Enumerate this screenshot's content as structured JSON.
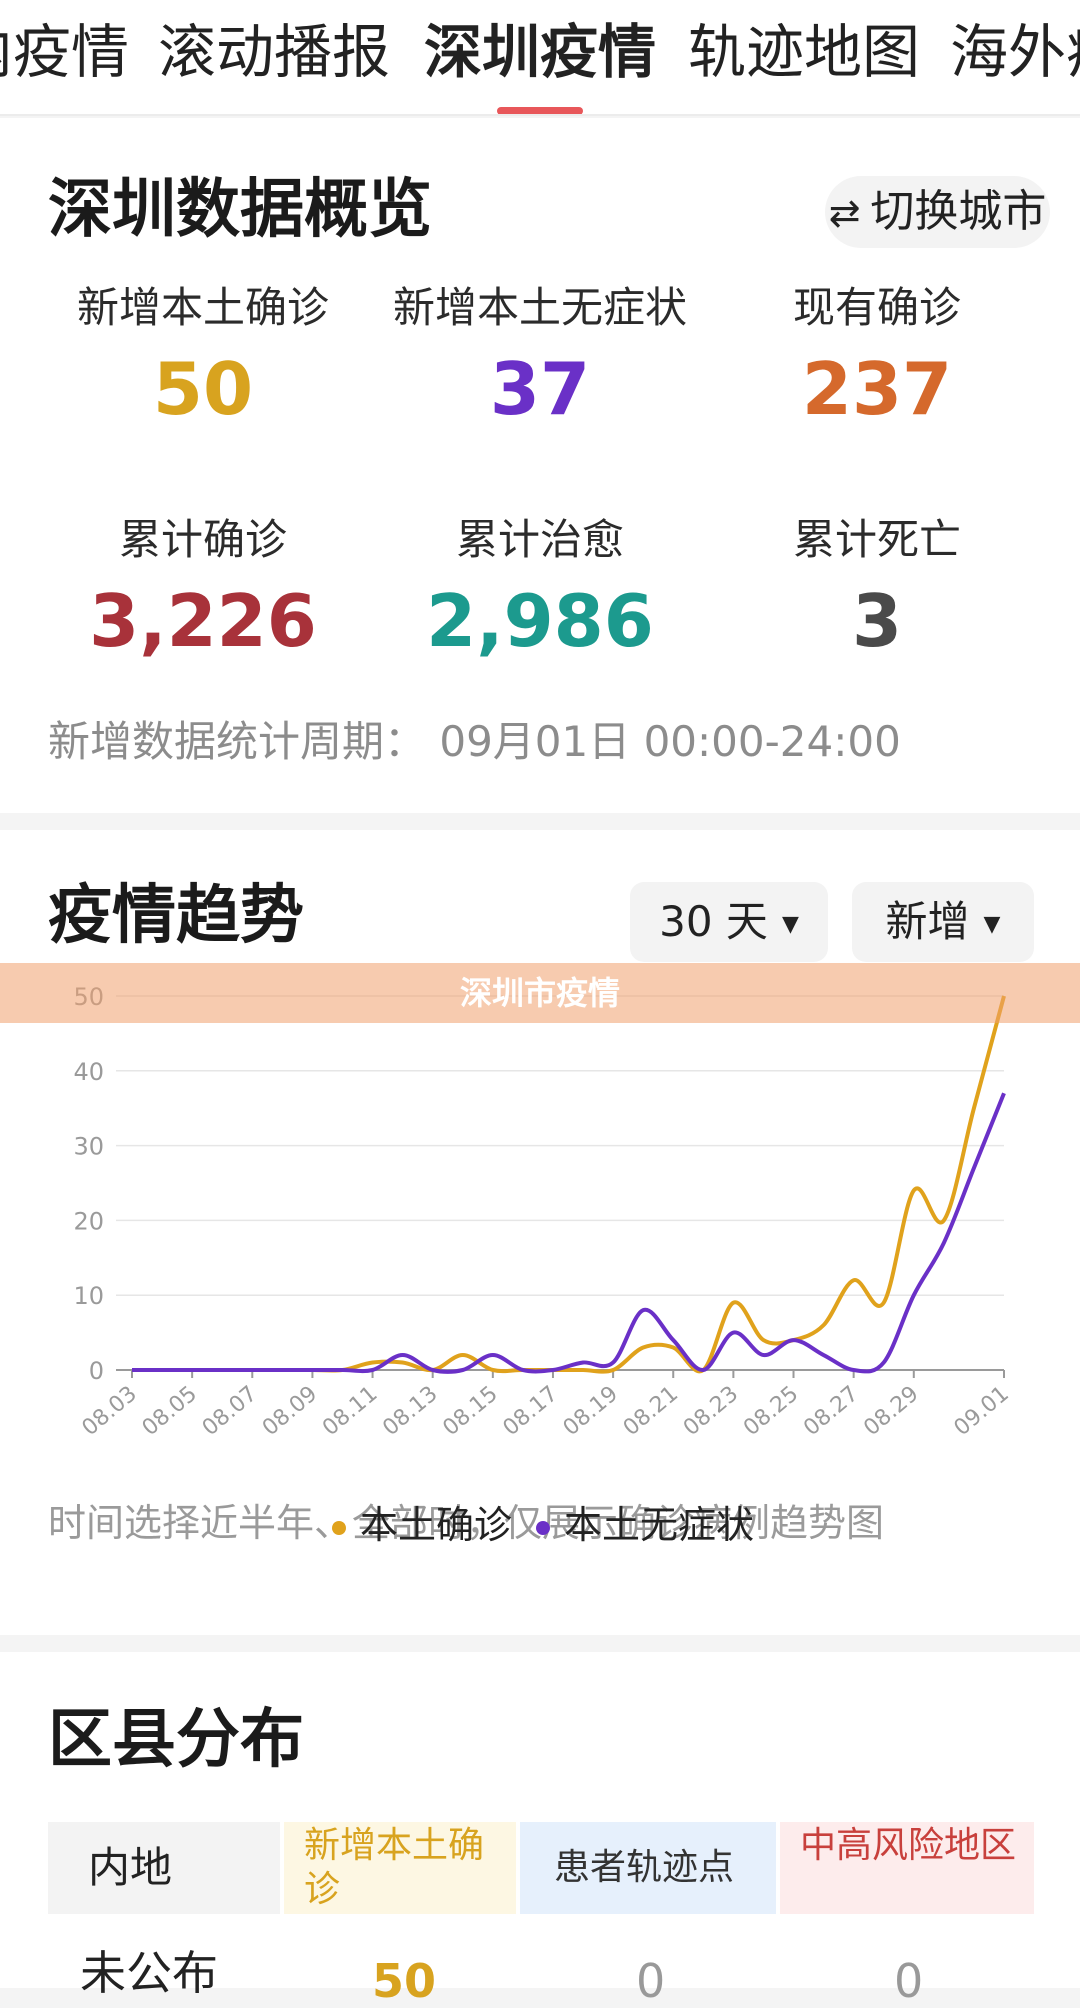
{
  "tabs": [
    "国内疫情",
    "滚动播报",
    "深圳疫情",
    "轨迹地图",
    "海外疫情"
  ],
  "overview": {
    "title": "深圳数据概览",
    "switch_label": "切换城市",
    "stats": [
      {
        "label": "新增本土确诊",
        "value": "50",
        "color": "#d8a31f"
      },
      {
        "label": "新增本土无症状",
        "value": "37",
        "color": "#6a30c7"
      },
      {
        "label": "现有确诊",
        "value": "237",
        "color": "#d5692c"
      },
      {
        "label": "累计确诊",
        "value": "3,226",
        "color": "#a8323a"
      },
      {
        "label": "累计治愈",
        "value": "2,986",
        "color": "#1c9a8e"
      },
      {
        "label": "累计死亡",
        "value": "3",
        "color": "#4a4a4a"
      }
    ],
    "period": "新增数据统计周期： 09月01日 00:00-24:00"
  },
  "trend": {
    "title": "疫情趋势",
    "range_label": "30 天",
    "mode_label": "新增",
    "banner": "深圳市疫情",
    "note": "时间选择近半年、全部时，仅展示确诊病例趋势图"
  },
  "chart_data": {
    "type": "line",
    "x": [
      "08.03",
      "08.04",
      "08.05",
      "08.06",
      "08.07",
      "08.08",
      "08.09",
      "08.10",
      "08.11",
      "08.12",
      "08.13",
      "08.14",
      "08.15",
      "08.16",
      "08.17",
      "08.18",
      "08.19",
      "08.20",
      "08.21",
      "08.22",
      "08.23",
      "08.24",
      "08.25",
      "08.26",
      "08.27",
      "08.28",
      "08.29",
      "08.30",
      "08.31",
      "09.01"
    ],
    "x_tick_labels": [
      "08.03",
      "08.05",
      "08.07",
      "08.09",
      "08.11",
      "08.13",
      "08.15",
      "08.17",
      "08.19",
      "08.21",
      "08.23",
      "08.25",
      "08.27",
      "08.29",
      "09.01"
    ],
    "yticks": [
      0,
      10,
      20,
      30,
      40,
      50
    ],
    "ylim": [
      0,
      50
    ],
    "grid": true,
    "legend_position": "bottom",
    "series": [
      {
        "name": "本土确诊",
        "color": "#e0a21c",
        "values": [
          0,
          0,
          0,
          0,
          0,
          0,
          0,
          0,
          1,
          1,
          0,
          2,
          0,
          0,
          0,
          0,
          0,
          3,
          3,
          0,
          9,
          4,
          4,
          6,
          12,
          9,
          24,
          20,
          35,
          50
        ]
      },
      {
        "name": "本土无症状",
        "color": "#6a30c7",
        "values": [
          0,
          0,
          0,
          0,
          0,
          0,
          0,
          0,
          0,
          2,
          0,
          0,
          2,
          0,
          0,
          1,
          1,
          8,
          4,
          0,
          5,
          2,
          4,
          2,
          0,
          1,
          10,
          17,
          27,
          37
        ]
      }
    ]
  },
  "district": {
    "title": "区县分布",
    "headers": [
      {
        "label": "内地",
        "color": "#222222",
        "bg": "#f3f3f3"
      },
      {
        "label": "新增本土确诊",
        "color": "#d8a31f",
        "bg": "#fdf7e3"
      },
      {
        "label": "患者轨迹点",
        "color": "#333333",
        "bg": "#e6f0fc"
      },
      {
        "label": "中高风险地区",
        "color": "#c8403c",
        "bg": "#fdecec"
      }
    ],
    "row": {
      "name": "未公布",
      "values": [
        "50",
        "0",
        "0"
      ]
    }
  }
}
